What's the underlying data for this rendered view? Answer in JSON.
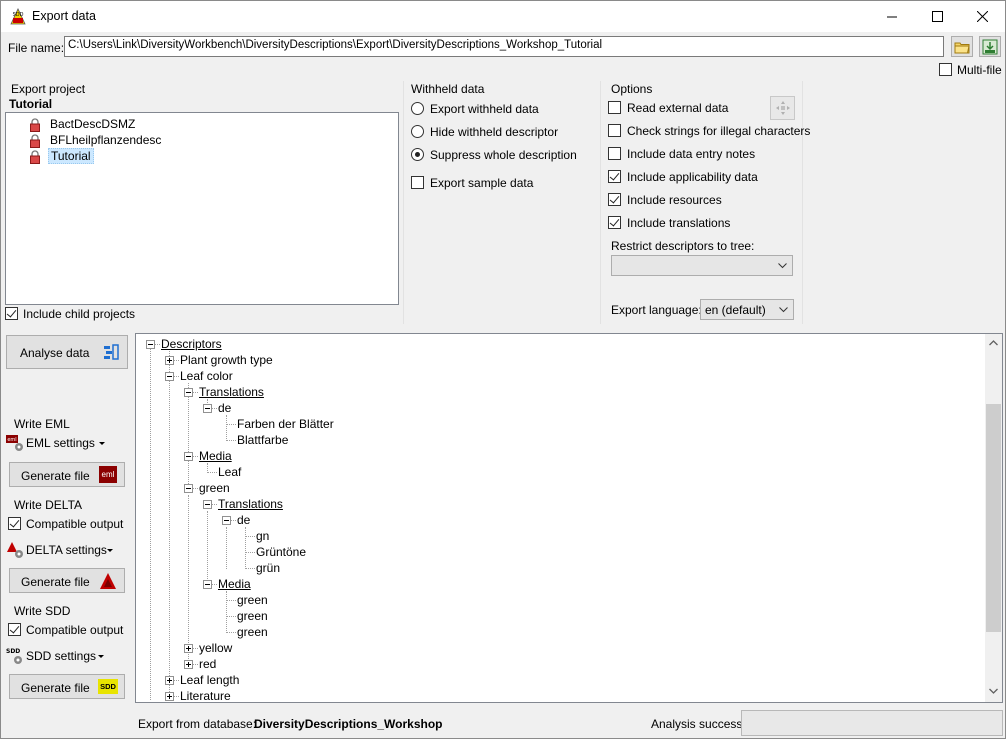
{
  "window": {
    "title": "Export data",
    "app_icon": "sdd-app-icon"
  },
  "file": {
    "label": "File name:",
    "path": "C:\\Users\\Link\\DiversityWorkbench\\DiversityDescriptions\\Export\\DiversityDescriptions_Workshop_Tutorial",
    "multifile_label": "Multi-file"
  },
  "export_project": {
    "heading": "Export project",
    "selected": "Tutorial",
    "items": [
      "BactDescDSMZ",
      "BFLheilpflanzendesc",
      "Tutorial"
    ],
    "include_child_label": "Include child projects"
  },
  "withheld": {
    "heading": "Withheld data",
    "options": [
      "Export withheld data",
      "Hide withheld descriptor",
      "Suppress whole description"
    ],
    "selected_index": 2,
    "sample_label": "Export sample data"
  },
  "options": {
    "heading": "Options",
    "checks": [
      {
        "label": "Read external data",
        "checked": false
      },
      {
        "label": "Check strings for illegal characters",
        "checked": false
      },
      {
        "label": "Include data entry notes",
        "checked": false
      },
      {
        "label": "Include applicability data",
        "checked": true
      },
      {
        "label": "Include resources",
        "checked": true
      },
      {
        "label": "Include translations",
        "checked": true
      }
    ],
    "restrict_label": "Restrict descriptors to tree:",
    "restrict_value": "",
    "language_label": "Export language:",
    "language_value": "en (default)"
  },
  "left": {
    "analyse_label": "Analyse data",
    "eml_heading": "Write EML",
    "eml_settings": "EML settings",
    "eml_generate": "Generate file",
    "delta_heading": "Write DELTA",
    "delta_compatible": "Compatible output",
    "delta_settings": "DELTA settings",
    "delta_generate": "Generate file",
    "sdd_heading": "Write SDD",
    "sdd_compatible": "Compatible output",
    "sdd_settings": "SDD settings",
    "sdd_generate": "Generate file",
    "eml_badge": "eml",
    "sdd_badge": "SDD"
  },
  "tree": {
    "nodes": [
      "Descriptors",
      "Plant growth type",
      "Leaf color",
      "Translations",
      "de",
      "Farben der Blätter",
      "Blattfarbe",
      "Media",
      "Leaf",
      "green",
      "Translations",
      "de",
      "gn",
      "Grüntöne",
      "grün",
      "Media",
      "green",
      "green",
      "green",
      "yellow",
      "red",
      "Leaf length",
      "Literature"
    ]
  },
  "status": {
    "db_label": "Export from database:",
    "db_value": "DiversityDescriptions_Workshop",
    "analysis_label": "Analysis success",
    "analysis_value": ""
  },
  "colors": {
    "selection": "#cce8ff",
    "delta_red": "#c00000",
    "eml_red": "#8b0000",
    "sdd_yellow": "#e8e400"
  }
}
